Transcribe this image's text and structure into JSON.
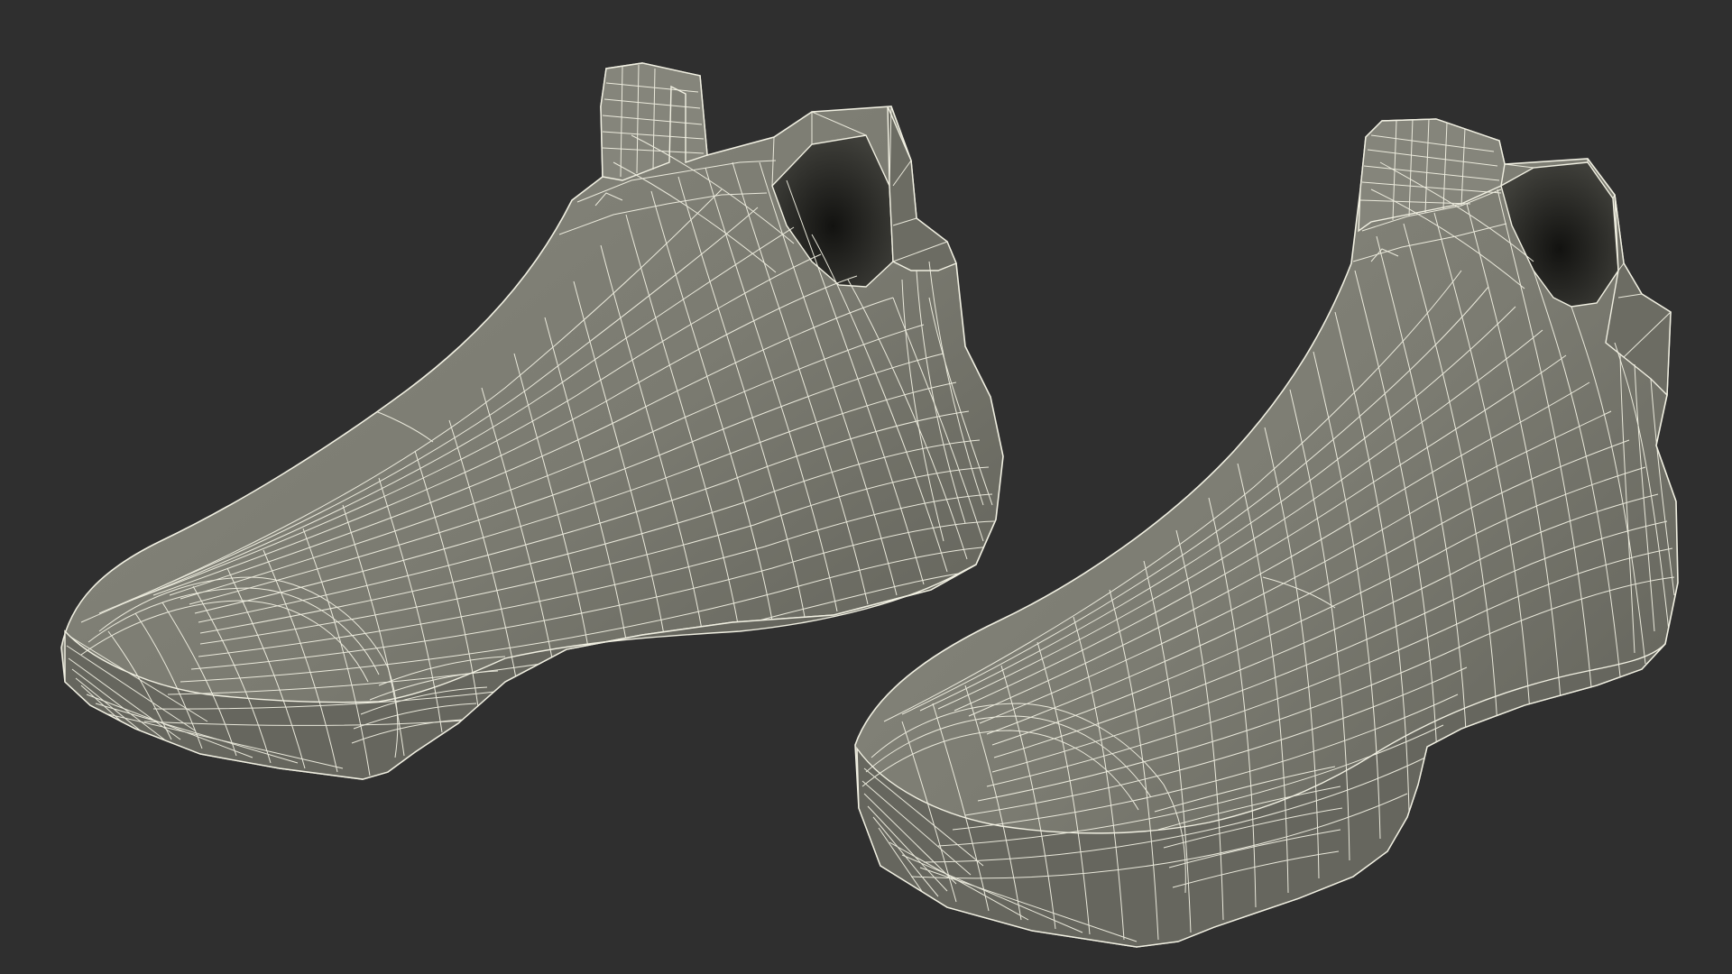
{
  "scene": {
    "subject": "wireframe-sneaker-pair",
    "shoe_count": 2,
    "colors": {
      "background": "#2f2f2f",
      "surface": "#7d7d73",
      "surface_shadow": "#5f5f57",
      "surface_light": "#8e8e84",
      "interior_dark": "#1a1a18",
      "wire": "#f1f0e2"
    }
  }
}
